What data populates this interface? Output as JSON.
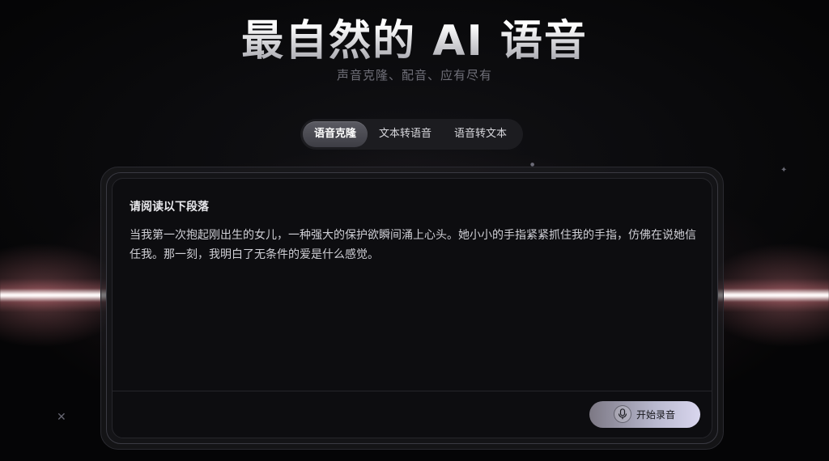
{
  "hero": {
    "title": "最自然的 AI 语音",
    "subtitle": "声音克隆、配音、应有尽有"
  },
  "tabs": [
    {
      "label": "语音克隆",
      "active": true
    },
    {
      "label": "文本转语音",
      "active": false
    },
    {
      "label": "语音转文本",
      "active": false
    }
  ],
  "card": {
    "heading": "请阅读以下段落",
    "text": "当我第一次抱起刚出生的女儿，一种强大的保护欲瞬间涌上心头。她小小的手指紧紧抓住我的手指，仿佛在说她信任我。那一刻，我明白了无条件的爱是什么感觉。",
    "record_button": "开始录音",
    "record_icon": "microphone-icon"
  },
  "colors": {
    "background": "#050506",
    "beam": "#ffffff",
    "beam_glow": "#ff8c96",
    "accent_button": "#c9c6e0"
  }
}
